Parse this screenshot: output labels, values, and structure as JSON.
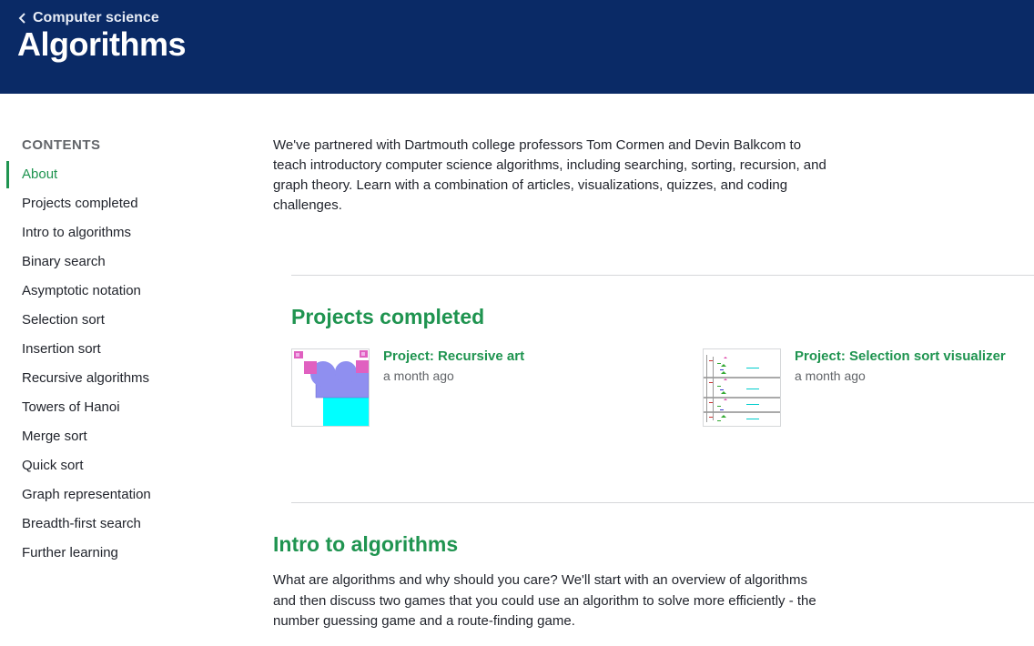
{
  "header": {
    "breadcrumb": "Computer science",
    "title": "Algorithms"
  },
  "sidebar": {
    "heading": "CONTENTS",
    "items": [
      {
        "label": "About"
      },
      {
        "label": "Projects completed"
      },
      {
        "label": "Intro to algorithms"
      },
      {
        "label": "Binary search"
      },
      {
        "label": "Asymptotic notation"
      },
      {
        "label": "Selection sort"
      },
      {
        "label": "Insertion sort"
      },
      {
        "label": "Recursive algorithms"
      },
      {
        "label": "Towers of Hanoi"
      },
      {
        "label": "Merge sort"
      },
      {
        "label": "Quick sort"
      },
      {
        "label": "Graph representation"
      },
      {
        "label": "Breadth-first search"
      },
      {
        "label": "Further learning"
      }
    ],
    "active_item": "About"
  },
  "main": {
    "intro": "We've partnered with Dartmouth college professors Tom Cormen and Devin Balkcom to teach introductory computer science algorithms, including searching, sorting, recursion, and graph theory. Learn with a combination of articles, visualizations, quizzes, and coding challenges.",
    "projects": {
      "title": "Projects completed",
      "items": [
        {
          "name": "Project: Recursive art",
          "time": "a month ago"
        },
        {
          "name": "Project: Selection sort visualizer",
          "time": "a month ago"
        }
      ]
    },
    "intro_algorithms": {
      "title": "Intro to algorithms",
      "text": "What are algorithms and why should you care? We'll start with an overview of algorithms and then discuss two games that you could use an algorithm to solve more efficiently - the number guessing game and a route-finding game."
    }
  },
  "colors": {
    "header_bg": "#0a2a66",
    "accent_green": "#1f9450",
    "divider": "#d6d8da"
  }
}
